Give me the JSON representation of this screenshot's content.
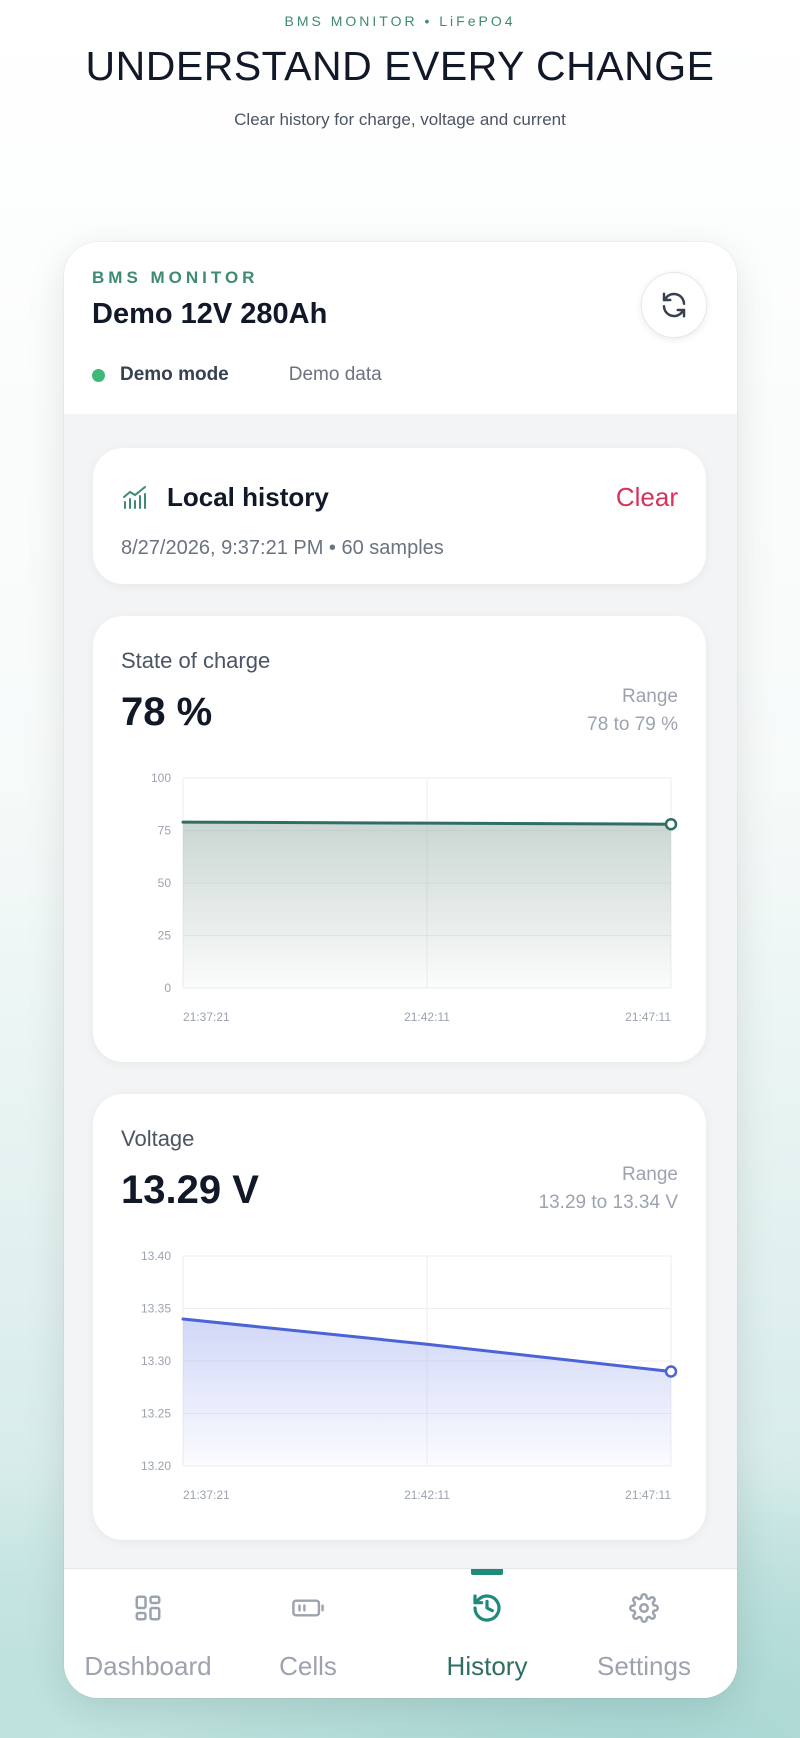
{
  "hero": {
    "eyebrow": "BMS MONITOR  •  LiFePO4",
    "title": "UNDERSTAND EVERY CHANGE",
    "subtitle": "Clear history for charge, voltage and current"
  },
  "app_header": {
    "eyebrow": "BMS MONITOR",
    "device_name": "Demo 12V 280Ah",
    "status": "Demo mode",
    "status_color": "#3fb97a",
    "secondary": "Demo data",
    "refresh_icon": "refresh-icon"
  },
  "history": {
    "icon": "chart-bars-icon",
    "title": "Local history",
    "clear_label": "Clear",
    "meta": "8/27/2026, 9:37:21 PM • 60 samples"
  },
  "soc": {
    "label": "State of charge",
    "value": "78 %",
    "range_label": "Range",
    "range_value": "78 to 79 %"
  },
  "voltage": {
    "label": "Voltage",
    "value": "13.29 V",
    "range_label": "Range",
    "range_value": "13.29 to 13.34 V"
  },
  "chart_data": [
    {
      "type": "area",
      "x": [
        "21:37:21",
        "21:42:11",
        "21:47:11"
      ],
      "y": [
        79,
        78.5,
        78
      ],
      "ylim": [
        0,
        100
      ],
      "yticks": [
        "100",
        "75",
        "50",
        "25",
        "0"
      ],
      "grid": true,
      "line_color": "#2f6e63",
      "fill_color": "#9fb5ae"
    },
    {
      "type": "area",
      "x": [
        "21:37:21",
        "21:42:11",
        "21:47:11"
      ],
      "y": [
        13.34,
        13.316,
        13.29
      ],
      "ylim": [
        13.2,
        13.4
      ],
      "yticks": [
        "13.40",
        "13.35",
        "13.30",
        "13.25",
        "13.20"
      ],
      "grid": true,
      "line_color": "#4a63d6",
      "fill_color": "#aab6f0"
    }
  ],
  "nav": {
    "items": [
      {
        "label": "Dashboard",
        "icon": "grid-icon"
      },
      {
        "label": "Cells",
        "icon": "battery-icon"
      },
      {
        "label": "History",
        "icon": "history-icon"
      },
      {
        "label": "Settings",
        "icon": "gear-icon"
      }
    ],
    "active": "History",
    "accent": "#1f8a7a"
  }
}
